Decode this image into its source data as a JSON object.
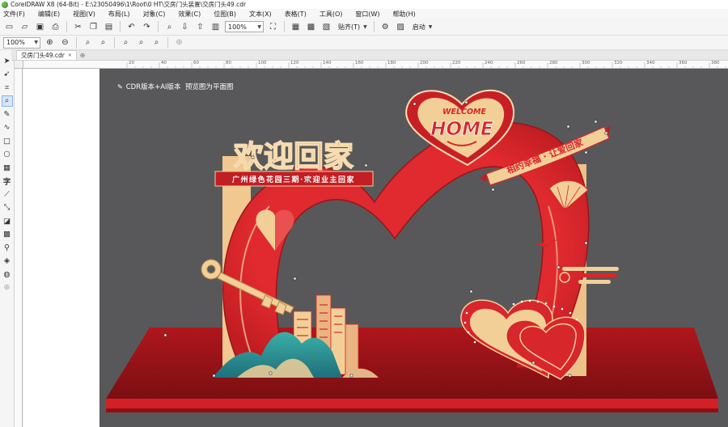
{
  "window": {
    "title": "CorelDRAW X8 (64-Bit) - E:\\23050496\\1\\Root\\0 HT\\交房门头装置\\交房门头49.cdr"
  },
  "menu": [
    "文件(F)",
    "编辑(E)",
    "视图(V)",
    "布局(L)",
    "对象(C)",
    "效果(C)",
    "位图(B)",
    "文本(X)",
    "表格(T)",
    "工具(O)",
    "窗口(W)",
    "帮助(H)"
  ],
  "toolbar": {
    "zoom_value": "100%",
    "snap_label": "贴齐(T)",
    "launch_label": "启动"
  },
  "propbar": {
    "zoom_value": "100%"
  },
  "document": {
    "tab_name": "交房门头49.cdr"
  },
  "ruler": {
    "ticks": [
      "20",
      "40",
      "60",
      "80",
      "100",
      "120",
      "140",
      "160",
      "180",
      "200",
      "220",
      "240",
      "260",
      "280",
      "300",
      "320",
      "340",
      "360",
      "380"
    ]
  },
  "artwork": {
    "caption": "CDR版本+AI版本  预览图为平面图",
    "headline": "欢迎回家",
    "subline": "广州绿色花园三期·欢迎业主回家",
    "heart_top_text": "WELCOME",
    "heart_main_text": "HOME",
    "ribbon_text": "相约幸福 · 让爱回家"
  },
  "colors": {
    "accent_red": "#d7262c",
    "dark_red": "#9a1519",
    "beige": "#f3cf98",
    "teal": "#2a9e9a",
    "canvas": "#58585a"
  }
}
